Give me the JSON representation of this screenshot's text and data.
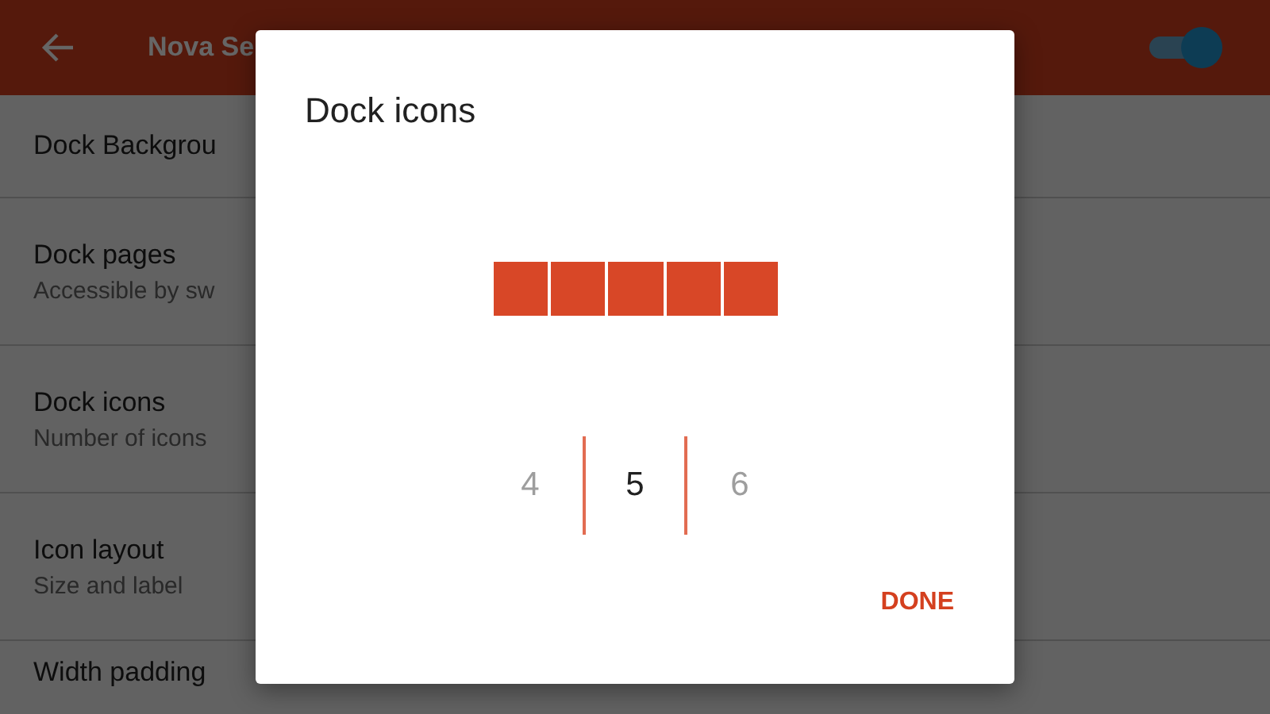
{
  "app_bar": {
    "title": "Nova Se",
    "switch_on": true
  },
  "settings": [
    {
      "title": "Dock Backgrou"
    },
    {
      "title": "Dock pages",
      "subtitle": "Accessible by sw"
    },
    {
      "title": "Dock icons",
      "subtitle": "Number of icons"
    },
    {
      "title": "Icon layout",
      "subtitle": "Size and label"
    },
    {
      "title": "Width padding"
    }
  ],
  "dialog": {
    "title": "Dock icons",
    "picker": [
      {
        "label": "4",
        "selected": false
      },
      {
        "label": "5",
        "selected": true
      },
      {
        "label": "6",
        "selected": false
      }
    ],
    "buttons": [
      "DONE"
    ]
  }
}
